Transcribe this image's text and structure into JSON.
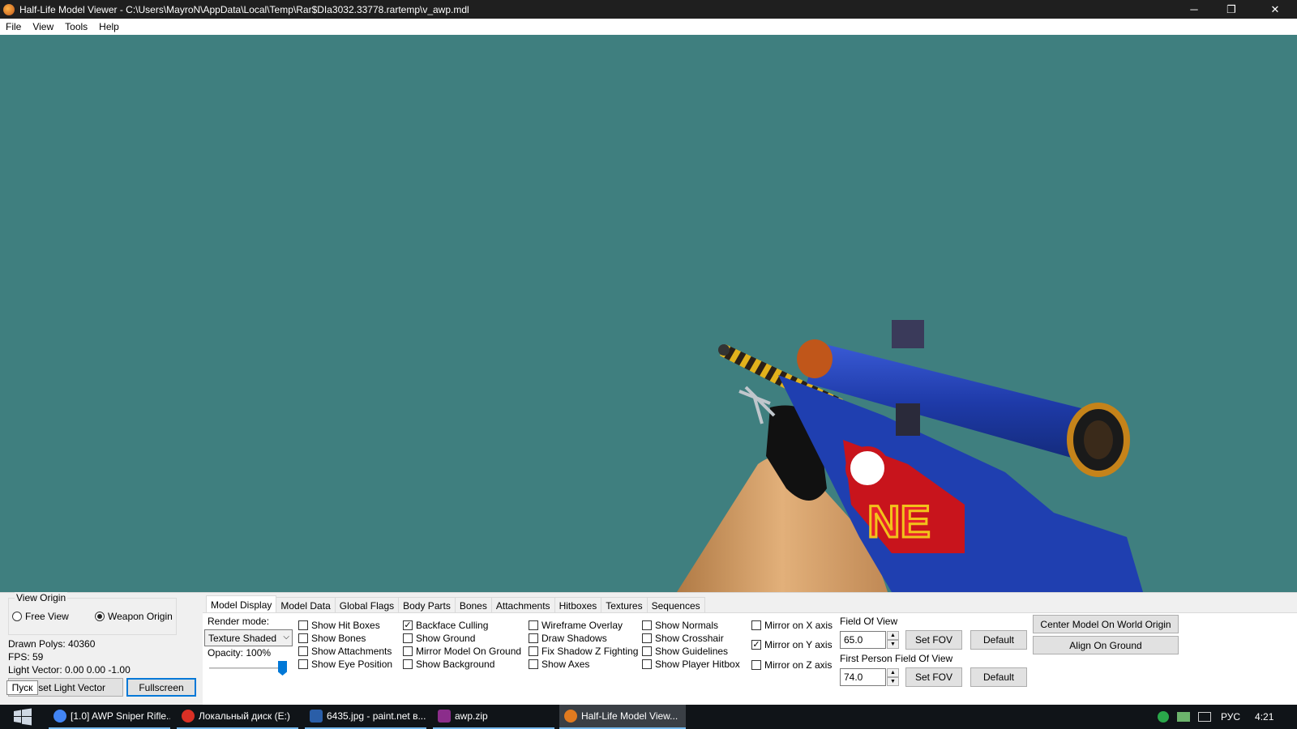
{
  "window": {
    "title": "Half-Life Model Viewer - C:\\Users\\MayroN\\AppData\\Local\\Temp\\Rar$DIa3032.33778.rartemp\\v_awp.mdl",
    "minimize_glyph": "─",
    "maximize_glyph": "❐",
    "close_glyph": "✕"
  },
  "menu": [
    "File",
    "View",
    "Tools",
    "Help"
  ],
  "view_origin": {
    "legend": "View Origin",
    "free_view": "Free View",
    "weapon_origin": "Weapon Origin",
    "selected": "Weapon Origin"
  },
  "stats": {
    "drawn_polys": "Drawn Polys: 40360",
    "fps": "FPS: 59",
    "light_vector": "Light Vector: 0.00 0.00 -1.00"
  },
  "buttons": {
    "reset_light_vector": "Reset Light Vector",
    "fullscreen": "Fullscreen",
    "set_fov": "Set FOV",
    "default": "Default",
    "set_fov_first": "Set FOV",
    "default_first": "Default",
    "center_model": "Center Model On World Origin",
    "align_ground": "Align On Ground"
  },
  "tooltip": "Пуск",
  "tabs": [
    "Model Display",
    "Model Data",
    "Global Flags",
    "Body Parts",
    "Bones",
    "Attachments",
    "Hitboxes",
    "Textures",
    "Sequences"
  ],
  "model_display": {
    "render_mode_label": "Render mode:",
    "render_mode_value": "Texture Shaded",
    "opacity_label": "Opacity: 100%",
    "opacity_value": 1.0,
    "checkboxes": [
      {
        "label": "Show Hit Boxes",
        "checked": false
      },
      {
        "label": "Show Bones",
        "checked": false
      },
      {
        "label": "Show Attachments",
        "checked": false
      },
      {
        "label": "Show Eye Position",
        "checked": false
      },
      {
        "label": "Backface Culling",
        "checked": true
      },
      {
        "label": "Show Ground",
        "checked": false
      },
      {
        "label": "Mirror Model On Ground",
        "checked": false
      },
      {
        "label": "Show Background",
        "checked": false
      },
      {
        "label": "Wireframe Overlay",
        "checked": false
      },
      {
        "label": "Draw Shadows",
        "checked": false
      },
      {
        "label": "Fix Shadow Z Fighting",
        "checked": false
      },
      {
        "label": "Show Axes",
        "checked": false
      },
      {
        "label": "Show Normals",
        "checked": false
      },
      {
        "label": "Show Crosshair",
        "checked": false
      },
      {
        "label": "Show Guidelines",
        "checked": false
      },
      {
        "label": "Show Player Hitbox",
        "checked": false
      }
    ],
    "mirror": [
      {
        "label": "Mirror on X axis",
        "checked": false
      },
      {
        "label": "Mirror on Y axis",
        "checked": true
      },
      {
        "label": "Mirror on Z axis",
        "checked": false
      }
    ],
    "fov_label": "Field Of View",
    "fov_value": "65.0",
    "first_fov_label": "First Person Field Of View",
    "first_fov_value": "74.0"
  },
  "taskbar": {
    "tasks": [
      {
        "label": "[1.0] AWP Sniper Rifle...",
        "color": "#4285f4"
      },
      {
        "label": "Локальный диск (E:)",
        "color": "#d93025"
      },
      {
        "label": "6435.jpg - paint.net в...",
        "color": "#2a5ea8"
      },
      {
        "label": "awp.zip",
        "color": "#8b2d8b"
      },
      {
        "label": "Half-Life Model View...",
        "color": "#e07a1f"
      }
    ],
    "language": "РУС",
    "time": "4:21"
  },
  "colors": {
    "viewport_bg": "#3f7f7f",
    "accent": "#0078d7"
  }
}
